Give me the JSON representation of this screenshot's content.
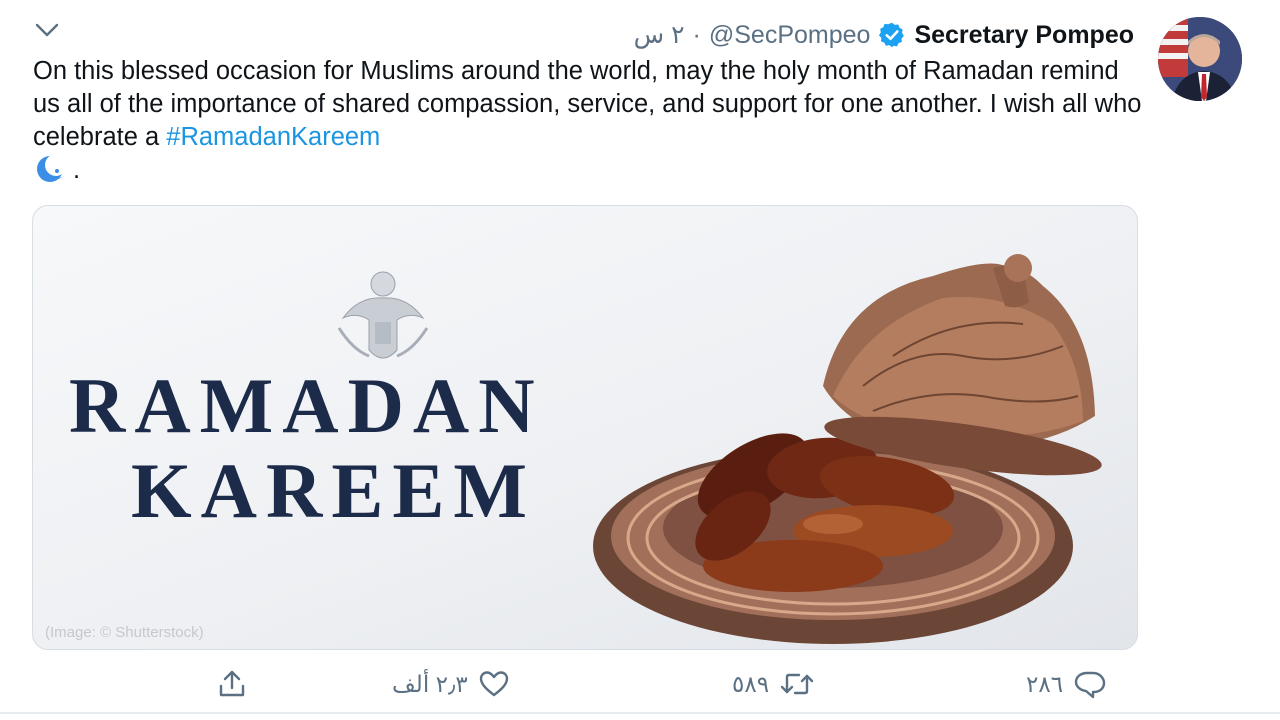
{
  "tweet": {
    "author_name": "Secretary Pompeo",
    "handle": "@SecPompeo",
    "separator": "·",
    "time": "٢ س",
    "text_main": "On this blessed occasion for Muslims around the world, may the holy month of Ramadan remind us all of the importance of shared compassion, service, and support for one another. I wish all who celebrate a ",
    "hashtag": "#RamadanKareem",
    "text_end": ".",
    "verified": true
  },
  "media": {
    "line1": "RAMADAN",
    "line2": "KAREEM",
    "credit": "(Image: © Shutterstock)"
  },
  "actions": {
    "reply_count": "٢٨٦",
    "retweet_count": "٥٨٩",
    "like_count": "٢٫٣ ألف"
  },
  "colors": {
    "accent": "#1b95e0",
    "verified": "#1da1f2",
    "muted": "#5b7083",
    "navy_text": "#1c2b4a"
  },
  "icons": [
    "chevron-down-icon",
    "verified-badge-icon",
    "crescent-moon-emoji",
    "share-icon",
    "like-icon",
    "retweet-icon",
    "reply-icon"
  ]
}
